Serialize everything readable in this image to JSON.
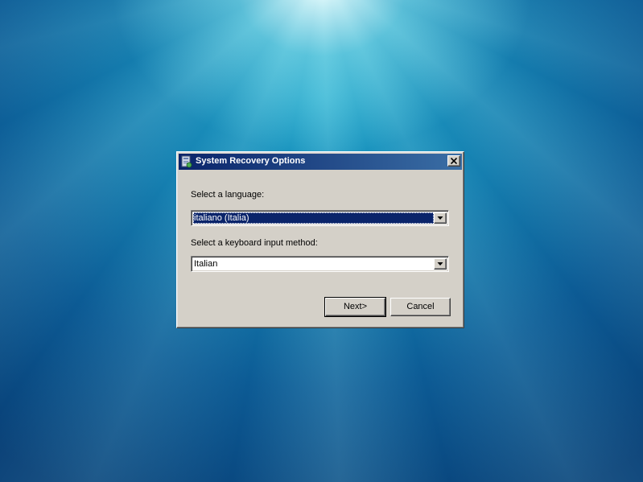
{
  "dialog": {
    "title": "System Recovery Options",
    "language_label": "Select a language:",
    "language_value": "italiano (Italia)",
    "keyboard_label": "Select a keyboard input method:",
    "keyboard_value": "Italian",
    "next_label": "Next>",
    "cancel_label": "Cancel",
    "icons": {
      "title": "recovery-app-icon",
      "close": "close-icon",
      "dropdown": "chevron-down-icon"
    }
  },
  "colors": {
    "titlebar_start": "#0a246a",
    "titlebar_end": "#3a6ea5",
    "selection": "#0a246a",
    "dialog_face": "#d4d0c8"
  }
}
